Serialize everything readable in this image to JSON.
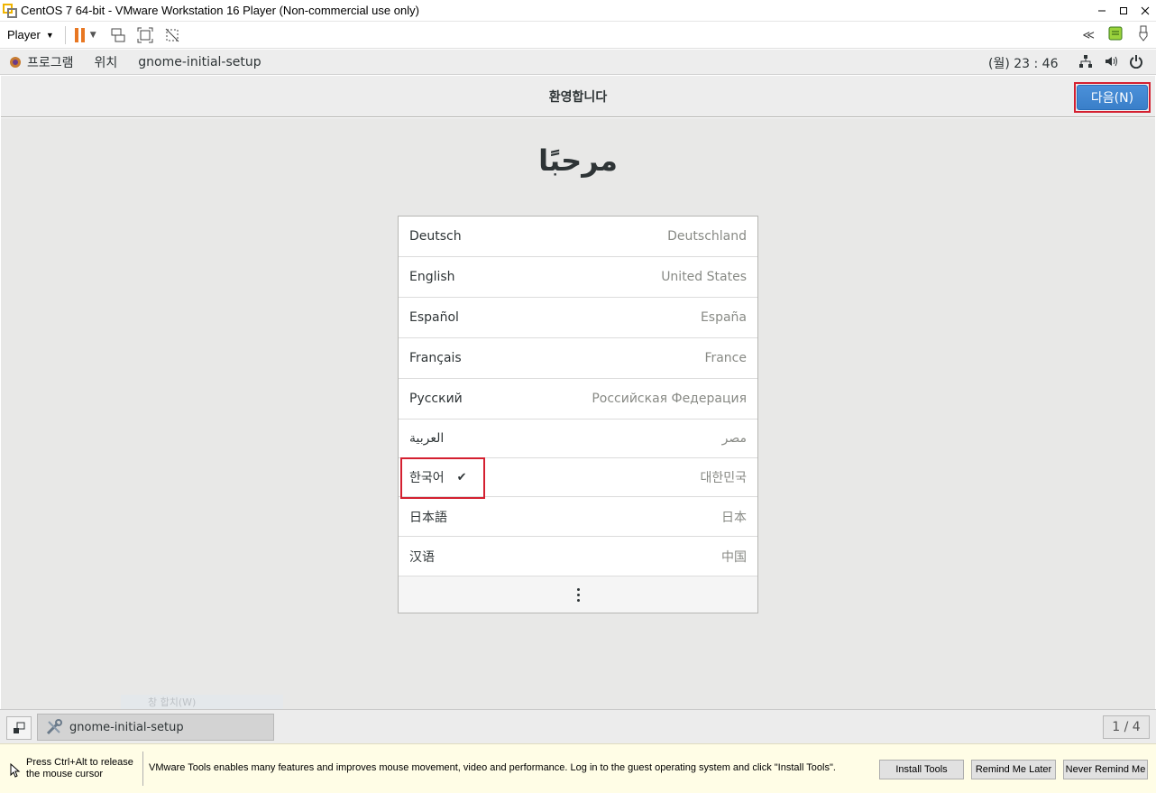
{
  "window": {
    "title": "CentOS 7 64-bit - VMware Workstation 16 Player (Non-commercial use only)",
    "controls": [
      "minimize-icon",
      "maximize-icon",
      "close-icon"
    ]
  },
  "vmware_toolbar": {
    "player_label": "Player",
    "pause_color": "#e87722"
  },
  "gnome_bar": {
    "menus": [
      "프로그램",
      "위치",
      "gnome-initial-setup"
    ],
    "clock": "(월) 23 : 46"
  },
  "header": {
    "title": "환영합니다",
    "next_button": "다음(N)",
    "accent": "#4a90d9"
  },
  "welcome_text": "مرحبًا",
  "languages": [
    {
      "name": "Deutsch",
      "region": "Deutschland",
      "selected": false
    },
    {
      "name": "English",
      "region": "United States",
      "selected": false
    },
    {
      "name": "Español",
      "region": "España",
      "selected": false
    },
    {
      "name": "Français",
      "region": "France",
      "selected": false
    },
    {
      "name": "Русский",
      "region": "Российская Федерация",
      "selected": false
    },
    {
      "name": "العربية",
      "region": "مصر",
      "selected": false
    },
    {
      "name": "한국어",
      "region": "대한민국",
      "selected": true
    },
    {
      "name": "日本語",
      "region": "日本",
      "selected": false
    },
    {
      "name": "汉语",
      "region": "中国",
      "selected": false
    }
  ],
  "ghost_menu_text": "창 합치(W)",
  "taskbar": {
    "task_label": "gnome-initial-setup",
    "workspace": "1 / 4"
  },
  "notification": {
    "release_hint": "Press Ctrl+Alt to release the mouse cursor",
    "message": "VMware Tools enables many features and improves mouse movement, video and performance. Log in to the guest operating system and click \"Install Tools\".",
    "install_button": "Install Tools",
    "remind_button": "Remind Me Later",
    "never_button": "Never Remind Me"
  }
}
